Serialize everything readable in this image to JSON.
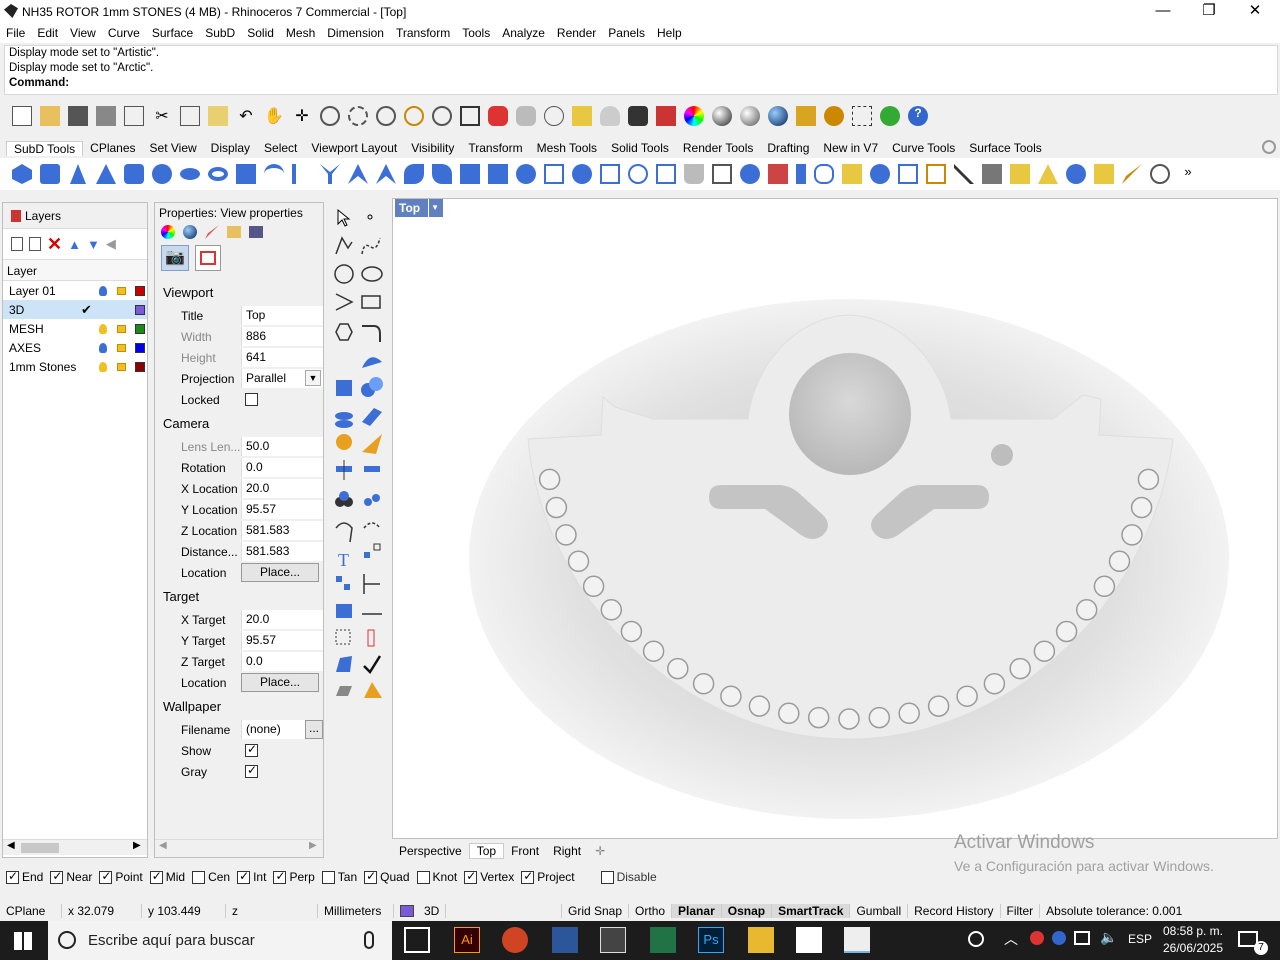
{
  "window": {
    "title": "NH35 ROTOR 1mm STONES (4 MB) - Rhinoceros 7 Commercial - [Top]"
  },
  "menu": [
    "File",
    "Edit",
    "View",
    "Curve",
    "Surface",
    "SubD",
    "Solid",
    "Mesh",
    "Dimension",
    "Transform",
    "Tools",
    "Analyze",
    "Render",
    "Panels",
    "Help"
  ],
  "command_history": [
    "Display mode set to \"Artistic\".",
    "Display mode set to \"Arctic\"."
  ],
  "command_prompt": "Command:",
  "toolbar_tabs": [
    "SubD Tools",
    "CPlanes",
    "Set View",
    "Display",
    "Select",
    "Viewport Layout",
    "Visibility",
    "Transform",
    "Mesh Tools",
    "Solid Tools",
    "Render Tools",
    "Drafting",
    "New in V7",
    "Curve Tools",
    "Surface Tools"
  ],
  "layers": {
    "tab": "Layers",
    "column": "Layer",
    "items": [
      {
        "name": "Layer 01",
        "color": "#cc0000"
      },
      {
        "name": "3D",
        "color": "#7a5ad8",
        "current": true
      },
      {
        "name": "MESH",
        "color": "#1a8a1a"
      },
      {
        "name": "AXES",
        "color": "#0000ee"
      },
      {
        "name": "1mm Stones",
        "color": "#8b0000"
      }
    ]
  },
  "properties": {
    "title": "Properties: View properties",
    "viewport_section": "Viewport",
    "camera_section": "Camera",
    "target_section": "Target",
    "wallpaper_section": "Wallpaper",
    "title_label": "Title",
    "title_val": "Top",
    "width_label": "Width",
    "width_val": "886",
    "height_label": "Height",
    "height_val": "641",
    "projection_label": "Projection",
    "projection_val": "Parallel",
    "locked_label": "Locked",
    "lens_label": "Lens Len...",
    "lens_val": "50.0",
    "rotation_label": "Rotation",
    "rotation_val": "0.0",
    "xloc_label": "X Location",
    "xloc_val": "20.0",
    "yloc_label": "Y Location",
    "yloc_val": "95.57",
    "zloc_label": "Z Location",
    "zloc_val": "581.583",
    "dist_label": "Distance...",
    "dist_val": "581.583",
    "location_label": "Location",
    "place_btn": "Place...",
    "xtgt_label": "X Target",
    "xtgt_val": "20.0",
    "ytgt_label": "Y Target",
    "ytgt_val": "95.57",
    "ztgt_label": "Z Target",
    "ztgt_val": "0.0",
    "filename_label": "Filename",
    "filename_val": "(none)",
    "browse_btn": "...",
    "show_label": "Show",
    "gray_label": "Gray"
  },
  "viewport": {
    "name": "Top"
  },
  "viewport_tabs": [
    "Perspective",
    "Top",
    "Front",
    "Right"
  ],
  "osnaps": [
    {
      "label": "End",
      "on": true
    },
    {
      "label": "Near",
      "on": true
    },
    {
      "label": "Point",
      "on": true
    },
    {
      "label": "Mid",
      "on": true
    },
    {
      "label": "Cen",
      "on": false
    },
    {
      "label": "Int",
      "on": true
    },
    {
      "label": "Perp",
      "on": true
    },
    {
      "label": "Tan",
      "on": false
    },
    {
      "label": "Quad",
      "on": true
    },
    {
      "label": "Knot",
      "on": false
    },
    {
      "label": "Vertex",
      "on": true
    },
    {
      "label": "Project",
      "on": true
    },
    {
      "label": "Disable",
      "on": false
    }
  ],
  "watermark": {
    "line1": "Activar Windows",
    "line2": "Ve a Configuración para activar Windows."
  },
  "status": {
    "cplane": "CPlane",
    "x": "x 32.079",
    "y": "y 103.449",
    "z": "z",
    "units": "Millimeters",
    "layer": "3D",
    "buttons": [
      "Grid Snap",
      "Ortho",
      "Planar",
      "Osnap",
      "SmartTrack",
      "Gumball",
      "Record History",
      "Filter"
    ],
    "tolerance": "Absolute tolerance: 0.001"
  },
  "taskbar": {
    "search_placeholder": "Escribe aquí para buscar",
    "lang": "ESP",
    "time": "08:58 p. m.",
    "date": "26/06/2025",
    "notif": "7"
  }
}
